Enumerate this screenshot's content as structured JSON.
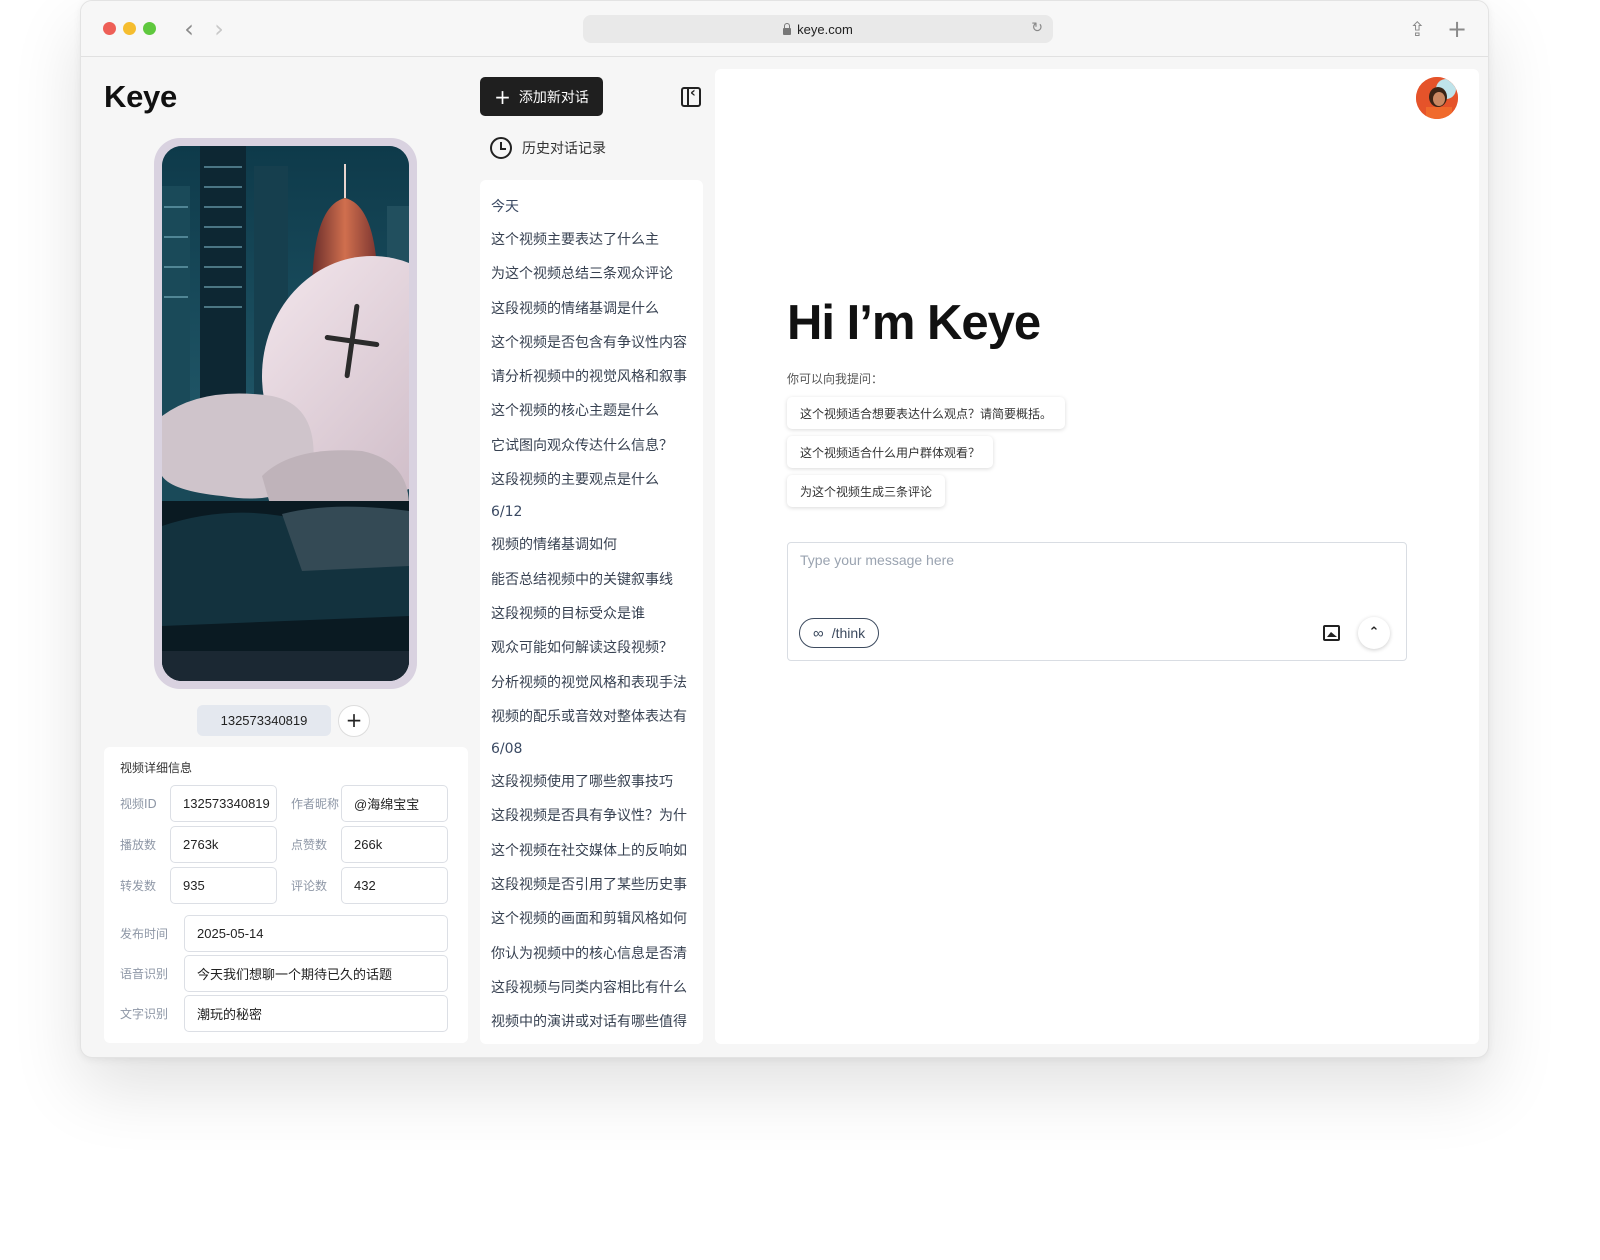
{
  "browser": {
    "url": "keye.com"
  },
  "app": {
    "logo": "Keye"
  },
  "video": {
    "id_chip": "132573340819",
    "details_title": "视频详细信息",
    "fields": {
      "video_id_label": "视频ID",
      "video_id": "132573340819",
      "author_label": "作者昵称",
      "author": "@海绵宝宝",
      "plays_label": "播放数",
      "plays": "2763k",
      "likes_label": "点赞数",
      "likes": "266k",
      "shares_label": "转发数",
      "shares": "935",
      "comments_label": "评论数",
      "comments": "432",
      "publish_label": "发布时间",
      "publish": "2025-05-14",
      "asr_label": "语音识别",
      "asr": "今天我们想聊一个期待已久的话题",
      "ocr_label": "文字识别",
      "ocr": "潮玩的秘密"
    }
  },
  "sidebar": {
    "new_chat_label": "添加新对话",
    "history_label": "历史对话记录",
    "history": {
      "group_today": "今天",
      "today": [
        "这个视频主要表达了什么主",
        "为这个视频总结三条观众评论",
        "这段视频的情绪基调是什么",
        "这个视频是否包含有争议性内容",
        "请分析视频中的视觉风格和叙事",
        "这个视频的核心主题是什么",
        "它试图向观众传达什么信息？",
        "这段视频的主要观点是什么"
      ],
      "group_612": "6/12",
      "d612": [
        "视频的情绪基调如何",
        "能否总结视频中的关键叙事线",
        "这段视频的目标受众是谁",
        "观众可能如何解读这段视频？",
        "分析视频的视觉风格和表现手法",
        "视频的配乐或音效对整体表达有"
      ],
      "group_608": "6/08",
      "d608": [
        "这段视频使用了哪些叙事技巧",
        "这段视频是否具有争议性？为什",
        "这个视频在社交媒体上的反响如",
        "这段视频是否引用了某些历史事",
        "这个视频的画面和剪辑风格如何",
        "你认为视频中的核心信息是否清",
        "这段视频与同类内容相比有什么",
        "视频中的演讲或对话有哪些值得"
      ]
    }
  },
  "main": {
    "greeting": "Hi I’m Keye",
    "ask_label": "你可以向我提问：",
    "suggestions": [
      "这个视频适合想要表达什么观点？请简要概括。",
      "这个视频适合什么用户群体观看？",
      "为这个视频生成三条评论"
    ],
    "input_placeholder": "Type your message here",
    "think_label": "/think",
    "think_icon": "infinity-icon",
    "image_icon": "image-icon",
    "send_icon": "chevron-up-icon"
  }
}
